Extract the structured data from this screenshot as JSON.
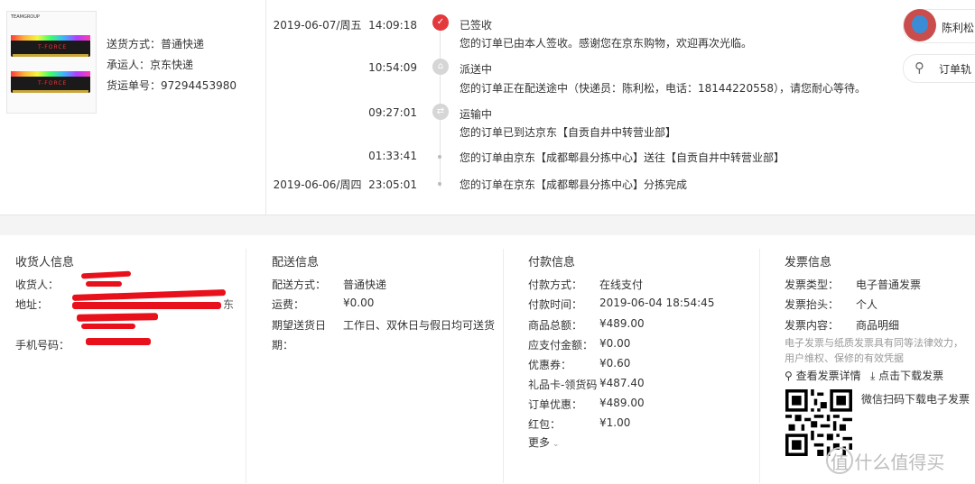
{
  "package": {
    "brand": "TEAMGROUP",
    "product_logo": "T-FORCE",
    "shipping_method": "送货方式：普通快递",
    "carrier": "承运人：京东快递",
    "tracking_no": "货运单号：97294453980"
  },
  "timeline": [
    {
      "date": "2019-06-07/周五",
      "time": "14:09:18",
      "title": "已签收",
      "desc": "您的订单已由本人签收。感谢您在京东购物，欢迎再次光临。",
      "icon": "check-icon"
    },
    {
      "date": "",
      "time": "10:54:09",
      "title": "派送中",
      "desc": "您的订单正在配送途中（快递员：陈利松，电话：18144220558），请您耐心等待。",
      "icon": "delivery-icon"
    },
    {
      "date": "",
      "time": "09:27:01",
      "title": "运输中",
      "desc": "您的订单已到达京东【自贡自井中转营业部】",
      "icon": "truck-icon"
    },
    {
      "date": "",
      "time": "01:33:41",
      "title": "",
      "desc": "您的订单由京东【成都郫县分拣中心】送往【自贡自井中转营业部】",
      "icon": "dot"
    },
    {
      "date": "2019-06-06/周四",
      "time": "23:05:01",
      "title": "",
      "desc": "您的订单在京东【成都郫县分拣中心】分拣完成",
      "icon": "dot"
    }
  ],
  "courier": {
    "name": "陈利松"
  },
  "track_button": {
    "label": "订单轨"
  },
  "receiver": {
    "title": "收货人信息",
    "name_label": "收货人：",
    "address_label": "地址：",
    "address_tail": "东",
    "phone_label": "手机号码："
  },
  "delivery": {
    "title": "配送信息",
    "rows": [
      {
        "label": "配送方式：",
        "value": "普通快递"
      },
      {
        "label": "运费：",
        "value": "¥0.00"
      },
      {
        "label": "期望送货日",
        "value": "工作日、双休日与假日均可送货"
      },
      {
        "label": "期：",
        "value": ""
      }
    ]
  },
  "payment": {
    "title": "付款信息",
    "rows": [
      {
        "label": "付款方式：",
        "value": "在线支付"
      },
      {
        "label": "付款时间：",
        "value": "2019-06-04 18:54:45"
      },
      {
        "label": "商品总额：",
        "value": "¥489.00"
      },
      {
        "label": "应支付金额：",
        "value": "¥0.00"
      },
      {
        "label": "优惠券：",
        "value": "¥0.60"
      },
      {
        "label": "礼品卡-领货码",
        "value": "¥487.40"
      },
      {
        "label": "订单优惠：",
        "value": "¥489.00"
      },
      {
        "label": "红包：",
        "value": "¥1.00"
      }
    ],
    "more": "更多"
  },
  "invoice": {
    "title": "发票信息",
    "rows": [
      {
        "label": "发票类型：",
        "value": "电子普通发票"
      },
      {
        "label": "发票抬头：",
        "value": "个人"
      },
      {
        "label": "发票内容：",
        "value": "商品明细"
      }
    ],
    "note_line1": "电子发票与纸质发票具有同等法律效力，",
    "note_line2": "用户维权、保修的有效凭据",
    "view_link": "查看发票详情",
    "download_link": "点击下载发票",
    "qr_caption": "微信扫码下载电子发票"
  },
  "watermark": "值 什么值得买",
  "colors": {
    "accent": "#e4393c",
    "redact": "#e8101a"
  }
}
